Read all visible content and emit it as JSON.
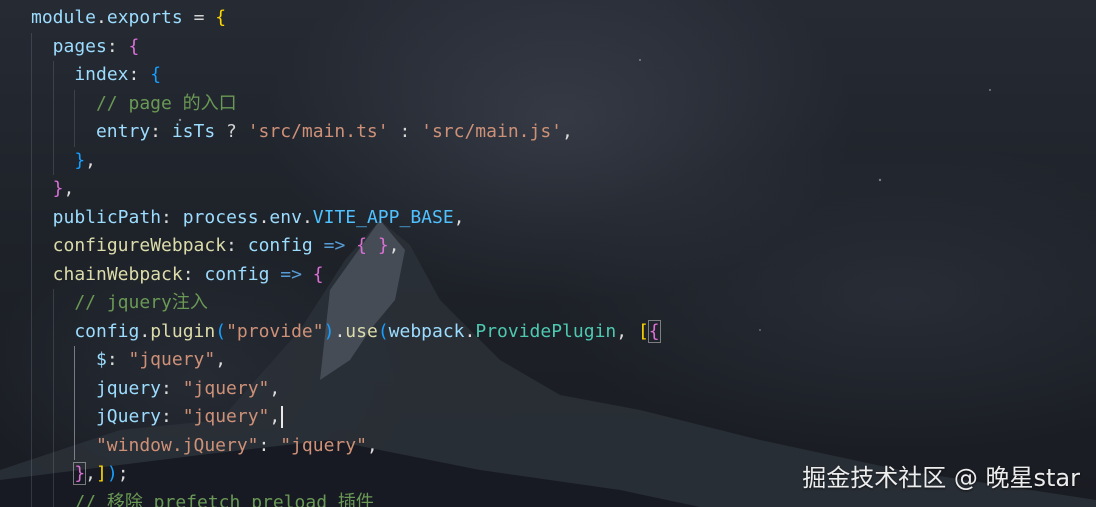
{
  "editor": {
    "lines": [
      [
        {
          "t": "module",
          "c": "t-var"
        },
        {
          "t": ".",
          "c": "t-default"
        },
        {
          "t": "exports",
          "c": "t-var"
        },
        {
          "t": " = ",
          "c": "t-op"
        },
        {
          "t": "{",
          "c": "b1"
        }
      ],
      [
        {
          "t": "pages",
          "c": "t-prop"
        },
        {
          "t": ": ",
          "c": "t-default"
        },
        {
          "t": "{",
          "c": "b2"
        }
      ],
      [
        {
          "t": "index",
          "c": "t-prop"
        },
        {
          "t": ": ",
          "c": "t-default"
        },
        {
          "t": "{",
          "c": "b3"
        }
      ],
      [
        {
          "t": "// page 的入口",
          "c": "t-cmt"
        }
      ],
      [
        {
          "t": "entry",
          "c": "t-prop"
        },
        {
          "t": ": ",
          "c": "t-default"
        },
        {
          "t": "isTs",
          "c": "t-var"
        },
        {
          "t": " ? ",
          "c": "t-op"
        },
        {
          "t": "'src/main.ts'",
          "c": "t-str"
        },
        {
          "t": " : ",
          "c": "t-op"
        },
        {
          "t": "'src/main.js'",
          "c": "t-str"
        },
        {
          "t": ",",
          "c": "t-default"
        }
      ],
      [
        {
          "t": "}",
          "c": "b3"
        },
        {
          "t": ",",
          "c": "t-default"
        }
      ],
      [
        {
          "t": "}",
          "c": "b2"
        },
        {
          "t": ",",
          "c": "t-default"
        }
      ],
      [
        {
          "t": "publicPath",
          "c": "t-prop"
        },
        {
          "t": ": ",
          "c": "t-default"
        },
        {
          "t": "process",
          "c": "t-var"
        },
        {
          "t": ".",
          "c": "t-default"
        },
        {
          "t": "env",
          "c": "t-var"
        },
        {
          "t": ".",
          "c": "t-default"
        },
        {
          "t": "VITE_APP_BASE",
          "c": "t-const"
        },
        {
          "t": ",",
          "c": "t-default"
        }
      ],
      [
        {
          "t": "configureWebpack",
          "c": "t-fn"
        },
        {
          "t": ": ",
          "c": "t-default"
        },
        {
          "t": "config",
          "c": "t-var"
        },
        {
          "t": " => ",
          "c": "t-kw"
        },
        {
          "t": "{",
          "c": "b2"
        },
        {
          "t": " ",
          "c": "t-default"
        },
        {
          "t": "}",
          "c": "b2"
        },
        {
          "t": ",",
          "c": "t-default"
        }
      ],
      [
        {
          "t": "chainWebpack",
          "c": "t-fn"
        },
        {
          "t": ": ",
          "c": "t-default"
        },
        {
          "t": "config",
          "c": "t-var"
        },
        {
          "t": " => ",
          "c": "t-kw"
        },
        {
          "t": "{",
          "c": "b2"
        }
      ],
      [
        {
          "t": "// jquery注入",
          "c": "t-cmt"
        }
      ],
      [
        {
          "t": "config",
          "c": "t-var"
        },
        {
          "t": ".",
          "c": "t-default"
        },
        {
          "t": "plugin",
          "c": "t-fn"
        },
        {
          "t": "(",
          "c": "b3"
        },
        {
          "t": "\"provide\"",
          "c": "t-str"
        },
        {
          "t": ")",
          "c": "b3"
        },
        {
          "t": ".",
          "c": "t-default"
        },
        {
          "t": "use",
          "c": "t-fn"
        },
        {
          "t": "(",
          "c": "b3"
        },
        {
          "t": "webpack",
          "c": "t-var"
        },
        {
          "t": ".",
          "c": "t-default"
        },
        {
          "t": "ProvidePlugin",
          "c": "t-cls"
        },
        {
          "t": ", ",
          "c": "t-default"
        },
        {
          "t": "[",
          "c": "b1"
        },
        {
          "t": "{",
          "c": "b2",
          "m": true
        }
      ],
      [
        {
          "t": "$",
          "c": "t-prop"
        },
        {
          "t": ": ",
          "c": "t-default"
        },
        {
          "t": "\"jquery\"",
          "c": "t-str"
        },
        {
          "t": ",",
          "c": "t-default"
        }
      ],
      [
        {
          "t": "jquery",
          "c": "t-prop"
        },
        {
          "t": ": ",
          "c": "t-default"
        },
        {
          "t": "\"jquery\"",
          "c": "t-str"
        },
        {
          "t": ",",
          "c": "t-default"
        }
      ],
      [
        {
          "t": "jQuery",
          "c": "t-prop"
        },
        {
          "t": ": ",
          "c": "t-default"
        },
        {
          "t": "\"jquery\"",
          "c": "t-str"
        },
        {
          "t": ",",
          "c": "t-default"
        },
        {
          "t": "",
          "c": "cursor"
        }
      ],
      [
        {
          "t": "\"window.jQuery\"",
          "c": "t-str"
        },
        {
          "t": ": ",
          "c": "t-default"
        },
        {
          "t": "\"jquery\"",
          "c": "t-str"
        },
        {
          "t": ",",
          "c": "t-default"
        }
      ],
      [
        {
          "t": "}",
          "c": "b2",
          "m": true
        },
        {
          "t": ",",
          "c": "t-default"
        },
        {
          "t": "]",
          "c": "b1"
        },
        {
          "t": ")",
          "c": "b3"
        },
        {
          "t": ";",
          "c": "t-default"
        }
      ],
      [
        {
          "t": "// 移除 prefetch preload 插件",
          "c": "t-cmt"
        }
      ]
    ]
  },
  "watermark": {
    "text": "掘金技术社区 @ 晚星star"
  }
}
